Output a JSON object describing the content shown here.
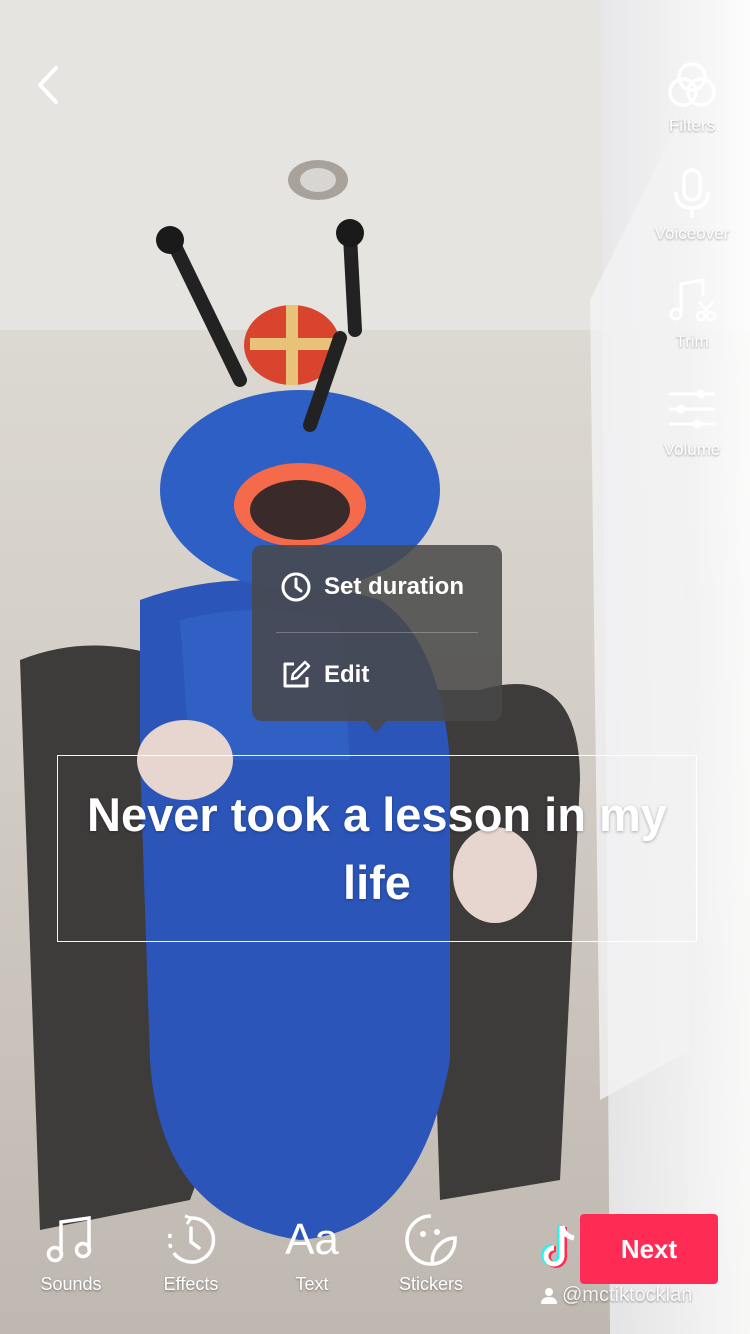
{
  "right_toolbar": {
    "filters": {
      "label": "Filters",
      "icon": "filters-icon"
    },
    "voiceover": {
      "label": "Voiceover",
      "icon": "microphone-icon"
    },
    "trim": {
      "label": "Trim",
      "icon": "music-scissors-icon"
    },
    "volume": {
      "label": "Volume",
      "icon": "sliders-icon"
    }
  },
  "text_menu": {
    "set_duration": {
      "label": "Set duration",
      "icon": "clock-icon"
    },
    "edit": {
      "label": "Edit",
      "icon": "edit-icon"
    }
  },
  "caption": {
    "text": "Never took a lesson in my life"
  },
  "bottom_toolbar": {
    "sounds": {
      "label": "Sounds",
      "icon": "music-note-icon"
    },
    "effects": {
      "label": "Effects",
      "icon": "effects-timer-icon"
    },
    "text": {
      "label": "Text",
      "icon_text": "Aa"
    },
    "stickers": {
      "label": "Stickers",
      "icon": "sticker-icon"
    }
  },
  "next_button": {
    "label": "Next",
    "color": "#fe2c55"
  },
  "watermark": {
    "handle": "@mctiktocklan"
  }
}
